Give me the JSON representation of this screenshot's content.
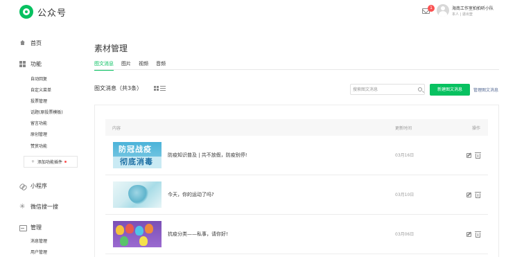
{
  "app": {
    "logo_text": "公众号"
  },
  "header": {
    "notification_count": "1",
    "account_name": "海南工作室拍拍听小队",
    "account_role": "本人 | 退出登"
  },
  "sidebar": {
    "home": "首页",
    "features": {
      "label": "功能",
      "items": [
        "自动回复",
        "自定义菜单",
        "投票管理",
        "话题(原投票模板)",
        "留言功能",
        "原创管理",
        "赞赏功能"
      ],
      "add_plugin": "添加功能插件"
    },
    "miniprogram": "小程序",
    "search": "微信搜一搜",
    "manage": {
      "label": "管理",
      "items": [
        "消息管理",
        "用户管理"
      ]
    }
  },
  "page": {
    "title": "素材管理",
    "tabs": [
      "图文消息",
      "图片",
      "视频",
      "音频"
    ],
    "active_tab": 0,
    "list_title": "图文消息（共3条）",
    "search_placeholder": "搜索图文消息",
    "new_button": "新建图文消息",
    "share_link": "管理图文消息"
  },
  "table": {
    "columns": [
      "内容",
      "更新时间",
      "操作"
    ],
    "rows": [
      {
        "title": "防疫知识普及 | 共不放假，防疫别停!",
        "date": "03月16日",
        "thumb_line1": "防冠战疫",
        "thumb_line2": "彻底消毒"
      },
      {
        "title": "今天，你的运动了吗?",
        "date": "03月10日"
      },
      {
        "title": "抗疫分类——私事，请你好!",
        "date": "03月06日"
      }
    ]
  },
  "colors": {
    "accent": "#07c160",
    "badge": "#fa5151",
    "link": "#576b95"
  }
}
